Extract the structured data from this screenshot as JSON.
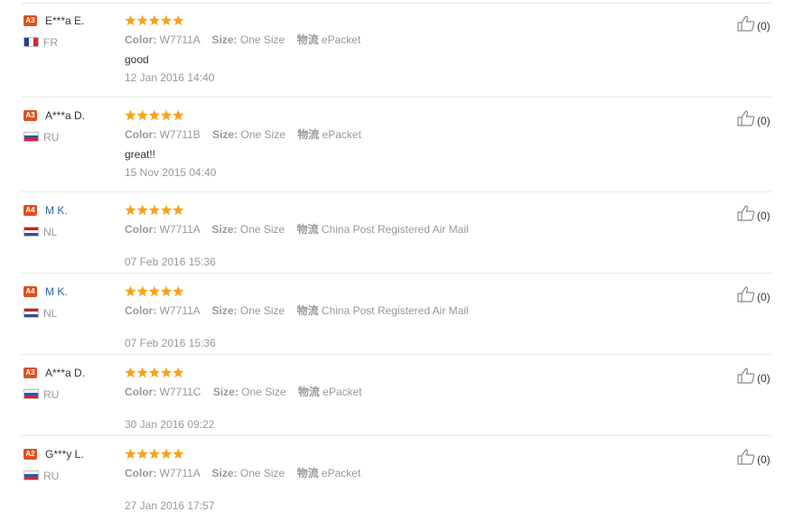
{
  "reviews": [
    {
      "level": "A3",
      "badge_color": "#e0501e",
      "buyer": "E***a E.",
      "buyer_color": "#333333",
      "country": "FR",
      "flag": "fr",
      "rating": 5,
      "color_label": "Color:",
      "color": "W7711A",
      "size_label": "Size:",
      "size": "One Size",
      "ship_label": "物流",
      "shipping": "ePacket",
      "text": "good",
      "date": "12 Jan 2016 14:40",
      "helpful": "(0)"
    },
    {
      "level": "A3",
      "badge_color": "#e0501e",
      "buyer": "A***a D.",
      "buyer_color": "#333333",
      "country": "RU",
      "flag": "ru",
      "rating": 5,
      "color_label": "Color:",
      "color": "W7711B",
      "size_label": "Size:",
      "size": "One Size",
      "ship_label": "物流",
      "shipping": "ePacket",
      "text": "great!!",
      "date": "15 Nov 2015 04:40",
      "helpful": "(0)"
    },
    {
      "level": "A4",
      "badge_color": "#e0501e",
      "buyer": "M K.",
      "buyer_color": "#2a62b0",
      "country": "NL",
      "flag": "nl",
      "rating": 5,
      "color_label": "Color:",
      "color": "W7711A",
      "size_label": "Size:",
      "size": "One Size",
      "ship_label": "物流",
      "shipping": "China Post Registered Air Mail",
      "text": "",
      "date": "07 Feb 2016 15:36",
      "helpful": "(0)"
    },
    {
      "level": "A4",
      "badge_color": "#e0501e",
      "buyer": "M K.",
      "buyer_color": "#2a62b0",
      "country": "NL",
      "flag": "nl",
      "rating": 5,
      "color_label": "Color:",
      "color": "W7711A",
      "size_label": "Size:",
      "size": "One Size",
      "ship_label": "物流",
      "shipping": "China Post Registered Air Mail",
      "text": "",
      "date": "07 Feb 2016 15:36",
      "helpful": "(0)"
    },
    {
      "level": "A3",
      "badge_color": "#e0501e",
      "buyer": "A***a D.",
      "buyer_color": "#333333",
      "country": "RU",
      "flag": "ru",
      "rating": 5,
      "color_label": "Color:",
      "color": "W7711C",
      "size_label": "Size:",
      "size": "One Size",
      "ship_label": "物流",
      "shipping": "ePacket",
      "text": "",
      "date": "30 Jan 2016 09:22",
      "helpful": "(0)"
    },
    {
      "level": "A2",
      "badge_color": "#e0501e",
      "buyer": "G***y L.",
      "buyer_color": "#333333",
      "country": "RU",
      "flag": "ru",
      "rating": 5,
      "color_label": "Color:",
      "color": "W7711A",
      "size_label": "Size:",
      "size": "One Size",
      "ship_label": "物流",
      "shipping": "ePacket",
      "text": "",
      "date": "27 Jan 2016 17:57",
      "helpful": "(0)"
    }
  ],
  "colors": {
    "star": "#f7a21b",
    "flag_fr": [
      "#1f3f9a",
      "#ffffff",
      "#d8262e"
    ],
    "flag_ru": [
      "#ffffff",
      "#2a56b8",
      "#d8262e"
    ],
    "flag_nl": [
      "#c8202f",
      "#ffffff",
      "#2c4f9e"
    ]
  },
  "icons": {
    "star": "star-icon",
    "helpful": "thumbs-up-icon"
  }
}
